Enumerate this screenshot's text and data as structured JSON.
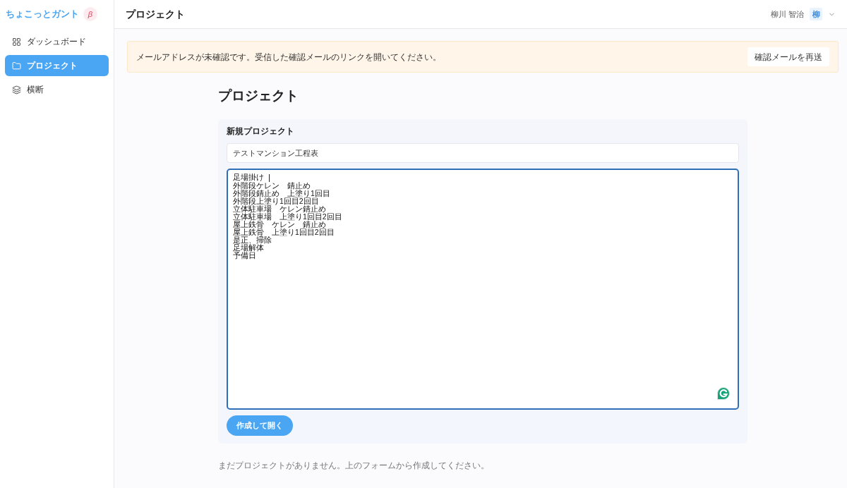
{
  "sidebar": {
    "logo": "ちょこっとガント",
    "badge": "β",
    "items": [
      {
        "label": "ダッシュボード",
        "kind": "grid",
        "selected": false
      },
      {
        "label": "プロジェクト",
        "kind": "folder",
        "selected": true
      },
      {
        "label": "横断",
        "kind": "layers",
        "selected": false
      }
    ]
  },
  "header": {
    "title": "プロジェクト",
    "user_name": "柳川 智治",
    "avatar": "柳"
  },
  "notice": {
    "message": "メールアドレスが未確認です。受信した確認メールのリンクを開いてください。",
    "button": "確認メールを再送"
  },
  "page": {
    "title": "プロジェクト"
  },
  "new_project": {
    "heading": "新規プロジェクト",
    "name_field": {
      "value": "テストマンション工程表"
    },
    "tasks_field": {
      "focused": true,
      "lines": [
        "足場掛け",
        "外階段ケレン　錆止め",
        "外階段錆止め　上塗り1回目",
        "外階段上塗り1回目2回目",
        "立体駐車場　ケレン錆止め",
        "立体駐車場　上塗り1回目2回目",
        "屋上鉄骨　ケレン　錆止め",
        "屋上鉄骨　上塗り1回目2回目",
        "是正、掃除",
        "足場解体",
        "予備日"
      ]
    },
    "submit": "作成して開く"
  },
  "empty_message": "まだプロジェクトがありません。上のフォームから作成してください。"
}
